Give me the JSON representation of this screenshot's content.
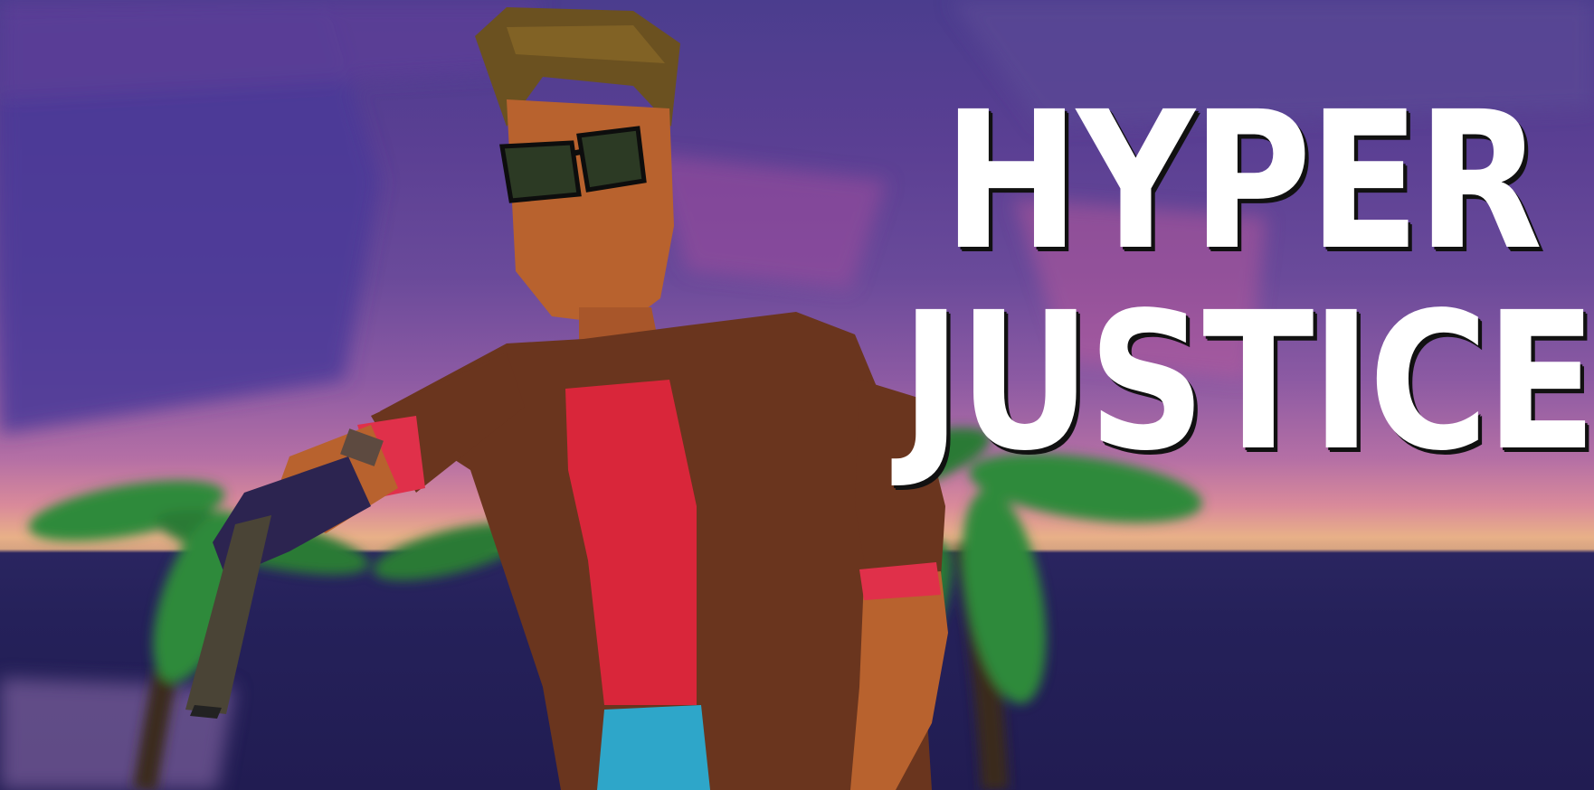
{
  "game": {
    "title_line1": "HYPER",
    "title_line2": "JUSTICE"
  },
  "colors": {
    "sky_top": "#4b3d8e",
    "sky_horizon": "#e8b088",
    "sea": "#211c52",
    "title_text": "#ffffff",
    "title_shadow": "#111111",
    "skin": "#b8622e",
    "jacket": "#6a351e",
    "shirt": "#d9263a",
    "pants": "#2ea6c9",
    "palm_leaves": "#2f8a3a"
  },
  "icons": {
    "character": "player-character",
    "weapon": "pistol-icon",
    "scenery": "palm-tree"
  }
}
